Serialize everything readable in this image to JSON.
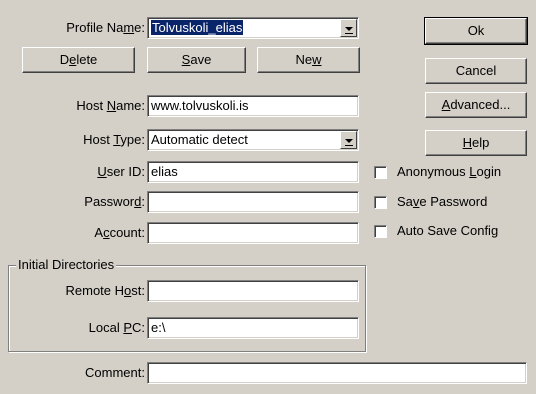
{
  "profile": {
    "label_pre": "Profile Na",
    "label_ul": "m",
    "label_post": "e:",
    "value": "Tolvuskoli_elias"
  },
  "buttons": {
    "delete": {
      "pre": "D",
      "ul": "e",
      "post": "lete"
    },
    "save": {
      "pre": "",
      "ul": "S",
      "post": "ave"
    },
    "new": {
      "pre": "Ne",
      "ul": "w",
      "post": ""
    },
    "ok": "Ok",
    "cancel": "Cancel",
    "advanced": {
      "pre": "",
      "ul": "A",
      "post": "dvanced..."
    },
    "help": {
      "pre": "",
      "ul": "H",
      "post": "elp"
    }
  },
  "host_name": {
    "label_pre": "Host ",
    "label_ul": "N",
    "label_post": "ame:",
    "value": "www.tolvuskoli.is"
  },
  "host_type": {
    "label_pre": "Host ",
    "label_ul": "T",
    "label_post": "ype:",
    "value": "Automatic detect"
  },
  "user_id": {
    "label_pre": "",
    "label_ul": "U",
    "label_post": "ser ID:",
    "value": "elias"
  },
  "password": {
    "label_pre": "Passwor",
    "label_ul": "d",
    "label_post": ":",
    "value": ""
  },
  "account": {
    "label_pre": "A",
    "label_ul": "c",
    "label_post": "count:",
    "value": ""
  },
  "checkboxes": {
    "anonymous": {
      "pre": "Anonymous ",
      "ul": "L",
      "post": "ogin",
      "checked": false
    },
    "save_password": {
      "pre": "Sa",
      "ul": "v",
      "post": "e Password",
      "checked": false
    },
    "auto_save": {
      "pre": "Auto Save Config",
      "ul": "",
      "post": "",
      "checked": false
    }
  },
  "initial_directories": {
    "title": "Initial Directories",
    "remote_host": {
      "label_pre": "Remote H",
      "label_ul": "o",
      "label_post": "st:",
      "value": ""
    },
    "local_pc": {
      "label_pre": "Local ",
      "label_ul": "P",
      "label_post": "C:",
      "value": "e:\\"
    }
  },
  "comment": {
    "label": "Comment:",
    "value": ""
  }
}
